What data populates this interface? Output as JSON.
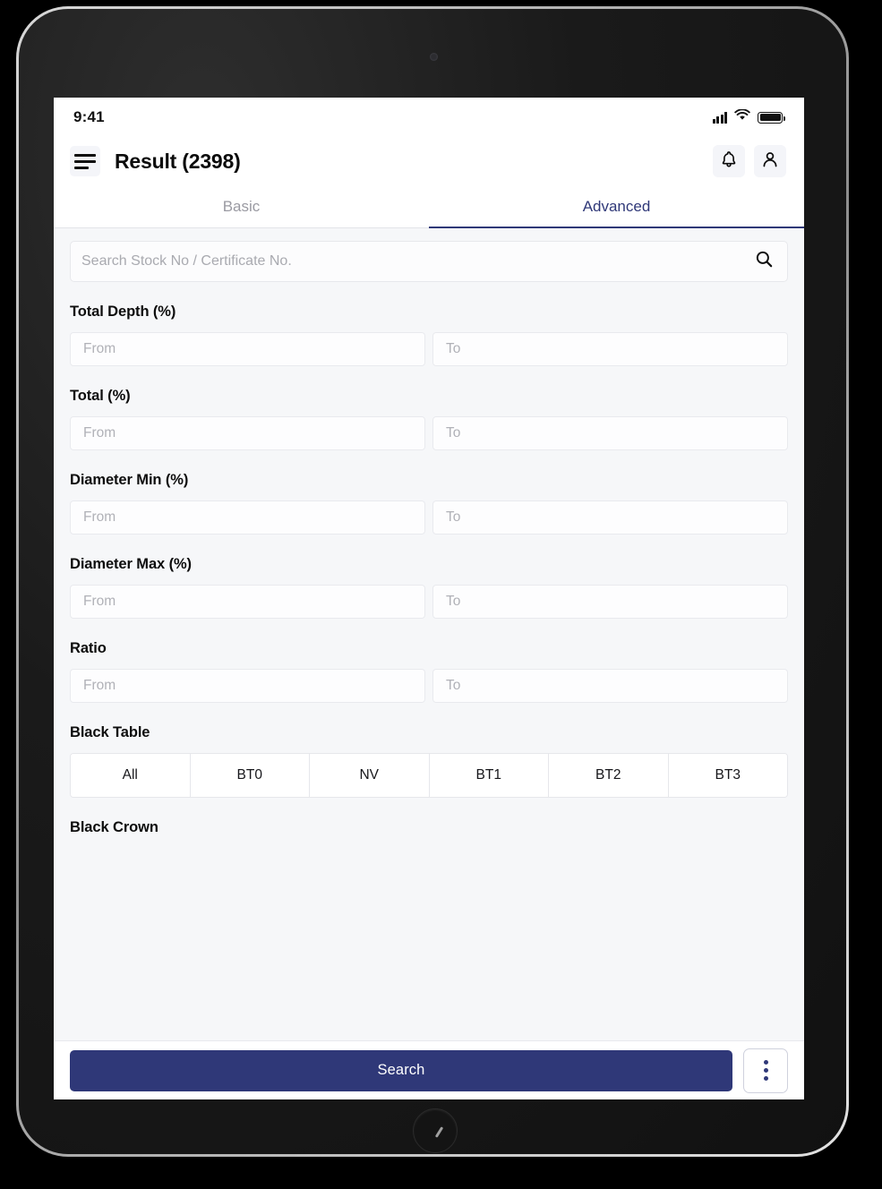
{
  "status_bar": {
    "time": "9:41",
    "signal_icon": "cellular-signal-icon",
    "wifi_icon": "wifi-icon",
    "battery_icon": "battery-full-icon"
  },
  "app_bar": {
    "menu_icon": "hamburger-menu-icon",
    "title": "Result (2398)",
    "notification_icon": "bell-icon",
    "profile_icon": "user-avatar-icon"
  },
  "tabs": [
    {
      "label": "Basic",
      "active": false
    },
    {
      "label": "Advanced",
      "active": true
    }
  ],
  "search": {
    "placeholder": "Search Stock No / Certificate No.",
    "value": "",
    "icon": "search-icon"
  },
  "filters": [
    {
      "label": "Total Depth (%)",
      "type": "range",
      "from_placeholder": "From",
      "from_value": "",
      "to_placeholder": "To",
      "to_value": ""
    },
    {
      "label": "Total (%)",
      "type": "range",
      "from_placeholder": "From",
      "from_value": "",
      "to_placeholder": "To",
      "to_value": ""
    },
    {
      "label": "Diameter Min (%)",
      "type": "range",
      "from_placeholder": "From",
      "from_value": "",
      "to_placeholder": "To",
      "to_value": ""
    },
    {
      "label": "Diameter Max (%)",
      "type": "range",
      "from_placeholder": "From",
      "from_value": "",
      "to_placeholder": "To",
      "to_value": ""
    },
    {
      "label": "Ratio",
      "type": "range",
      "from_placeholder": "From",
      "from_value": "",
      "to_placeholder": "To",
      "to_value": ""
    },
    {
      "label": "Black Table",
      "type": "segmented",
      "options": [
        "All",
        "BT0",
        "NV",
        "BT1",
        "BT2",
        "BT3"
      ]
    },
    {
      "label": "Black Crown",
      "type": "section-label-partial"
    }
  ],
  "bottom_bar": {
    "search_label": "Search",
    "more_icon": "more-vertical-icon"
  },
  "colors": {
    "accent": "#2f3878",
    "page_background": "#f6f7f9",
    "surface": "#ffffff",
    "border": "#e7e8ec",
    "text_primary": "#0d0d0d",
    "text_muted": "#9a9aa2",
    "placeholder": "#b0b1b7"
  }
}
